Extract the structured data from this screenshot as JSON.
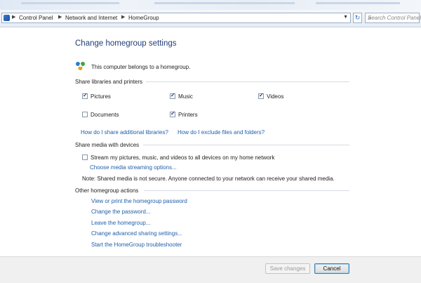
{
  "breadcrumb": {
    "items": [
      "Control Panel",
      "Network and Internet",
      "HomeGroup"
    ]
  },
  "search": {
    "placeholder": "Search Control Panel"
  },
  "page": {
    "title": "Change homegroup settings",
    "status_text": "This computer belongs to a homegroup."
  },
  "share_libraries": {
    "heading": "Share libraries and printers",
    "items": [
      {
        "label": "Pictures",
        "checked": true
      },
      {
        "label": "Music",
        "checked": true
      },
      {
        "label": "Videos",
        "checked": true
      },
      {
        "label": "Documents",
        "checked": false
      },
      {
        "label": "Printers",
        "checked": true
      }
    ],
    "link_additional": "How do I share additional libraries?",
    "link_exclude": "How do I exclude files and folders?"
  },
  "share_media": {
    "heading": "Share media with devices",
    "stream_label": "Stream my pictures, music, and videos to all devices on my home network",
    "stream_checked": false,
    "options_link": "Choose media streaming options...",
    "note": "Note: Shared media is not secure. Anyone connected to your network can receive your shared media."
  },
  "other_actions": {
    "heading": "Other homegroup actions",
    "links": [
      "View or print the homegroup password",
      "Change the password...",
      "Leave the homegroup...",
      "Change advanced sharing settings...",
      "Start the HomeGroup troubleshooter"
    ]
  },
  "footer": {
    "save_label": "Save changes",
    "save_enabled": false,
    "cancel_label": "Cancel"
  },
  "colors": {
    "title": "#1e3e78",
    "link": "#1f5fa8",
    "accent": "#3c7fb1"
  }
}
